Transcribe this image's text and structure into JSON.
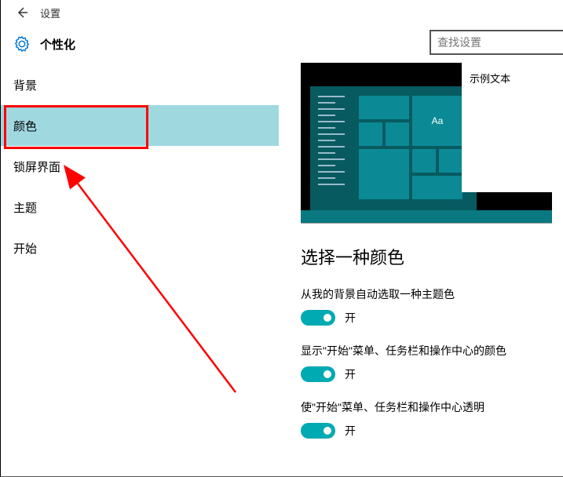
{
  "titlebar": {
    "app": "设置"
  },
  "header": {
    "page_title": "个性化",
    "search_placeholder": "查找设置"
  },
  "sidebar": {
    "items": [
      {
        "label": "背景"
      },
      {
        "label": "颜色"
      },
      {
        "label": "锁屏界面"
      },
      {
        "label": "主题"
      },
      {
        "label": "开始"
      }
    ]
  },
  "preview": {
    "sample_text": "示例文本",
    "tile_text": "Aa"
  },
  "content": {
    "section_title": "选择一种颜色",
    "settings": [
      {
        "label": "从我的背景自动选取一种主题色",
        "state": "开"
      },
      {
        "label": "显示\"开始\"菜单、任务栏和操作中心的颜色",
        "state": "开"
      },
      {
        "label": "使\"开始\"菜单、任务栏和操作中心透明",
        "state": "开"
      }
    ]
  }
}
